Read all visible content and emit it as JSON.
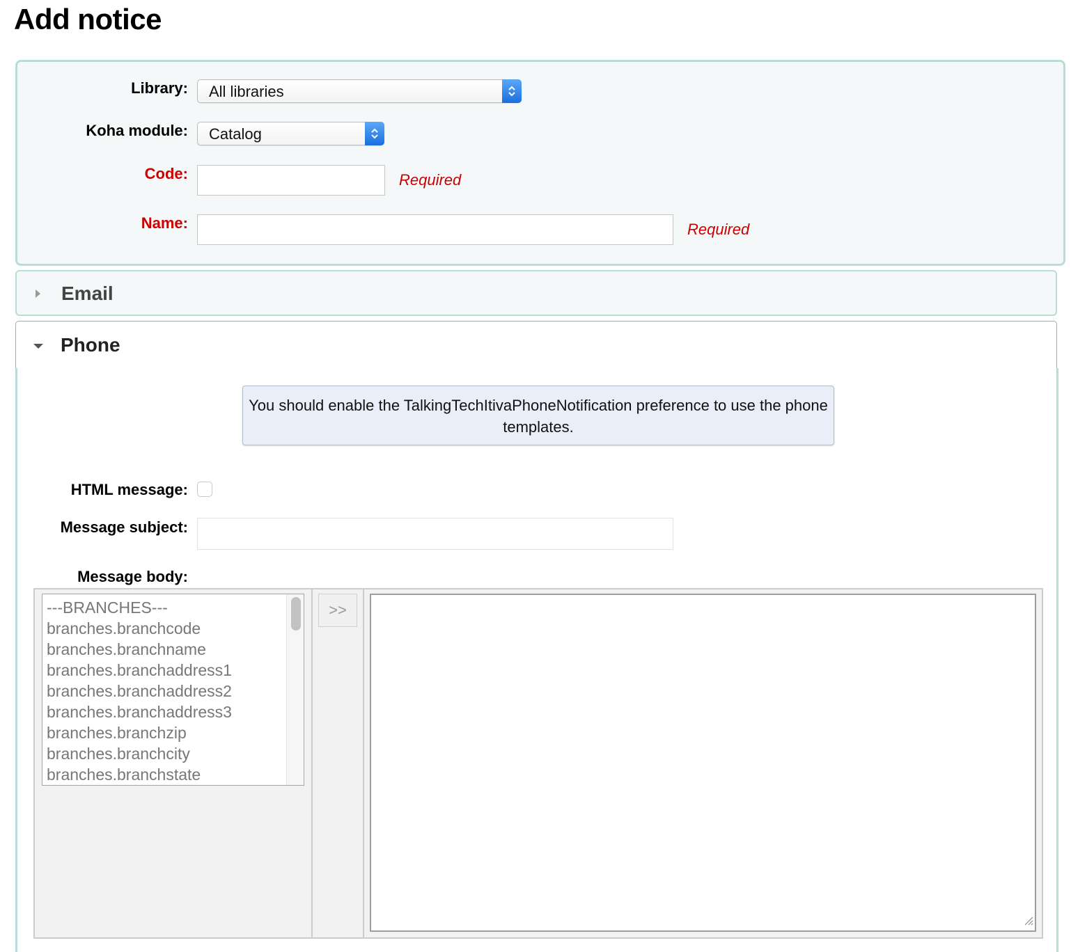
{
  "page": {
    "title": "Add notice"
  },
  "form": {
    "library": {
      "label": "Library:",
      "value": "All libraries"
    },
    "module": {
      "label": "Koha module:",
      "value": "Catalog"
    },
    "code": {
      "label": "Code:",
      "value": "",
      "required_note": "Required"
    },
    "name": {
      "label": "Name:",
      "value": "",
      "required_note": "Required"
    }
  },
  "sections": {
    "email": {
      "title": "Email",
      "state": "collapsed"
    },
    "phone": {
      "title": "Phone",
      "state": "expanded"
    }
  },
  "phone": {
    "notice": "You should enable the TalkingTechItivaPhoneNotification preference to use the phone templates.",
    "html_message": {
      "label": "HTML message:",
      "checked": false
    },
    "subject": {
      "label": "Message subject:",
      "value": ""
    },
    "body": {
      "label": "Message body:",
      "value": ""
    },
    "insert_button": ">>",
    "fields": [
      "---BRANCHES---",
      "branches.branchcode",
      "branches.branchname",
      "branches.branchaddress1",
      "branches.branchaddress2",
      "branches.branchaddress3",
      "branches.branchzip",
      "branches.branchcity",
      "branches.branchstate"
    ]
  },
  "colors": {
    "required": "#cc0000",
    "fieldset_border": "#b8dcd8",
    "fieldset_bg": "#f4f8f9",
    "select_accent": "#1a6fe0"
  }
}
